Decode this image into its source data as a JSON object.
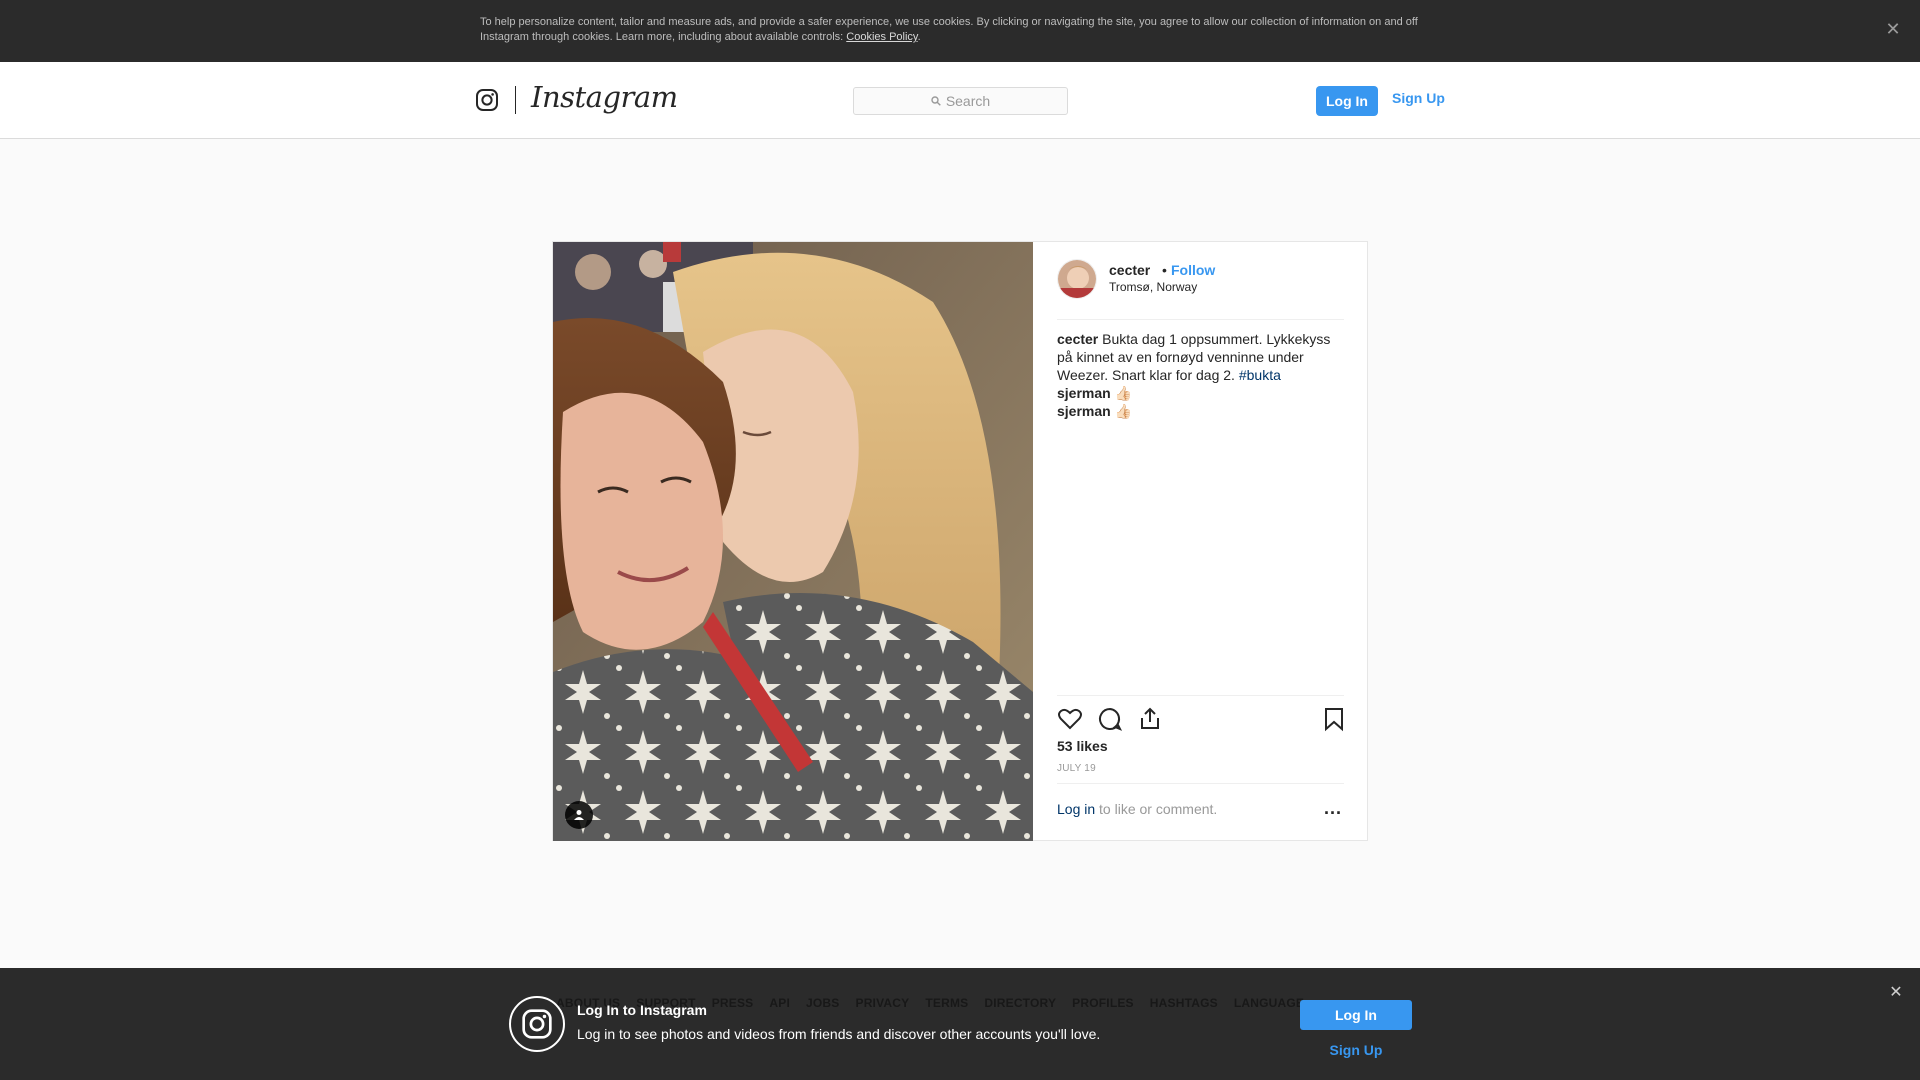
{
  "cookie": {
    "text": "To help personalize content, tailor and measure ads, and provide a safer experience, we use cookies. By clicking or navigating the site, you agree to allow our collection of information on and off Instagram through cookies. Learn more, including about available controls: ",
    "link": "Cookies Policy",
    "period": ".",
    "close_icon": "close-icon"
  },
  "header": {
    "wordmark": "Instagram",
    "search_placeholder": "Search",
    "login_label": "Log In",
    "signup_label": "Sign Up"
  },
  "post": {
    "username": "cecter",
    "separator": "•",
    "follow_label": "Follow",
    "location": "Tromsø, Norway",
    "caption_user": "cecter",
    "caption_text": " Bukta dag 1 oppsummert. Lykkekyss på kinnet av en fornøyd venninne under Weezer. Snart klar for dag 2. ",
    "caption_hashtag": "#bukta",
    "comments": [
      {
        "user": "sjerman",
        "text": " 👍🏻"
      },
      {
        "user": "sjerman",
        "text": " 👍🏻"
      }
    ],
    "likes": "53 likes",
    "date": "JULY 19",
    "comment_login_link": "Log in",
    "comment_login_text": " to like or comment.",
    "more_label": "..."
  },
  "footer": {
    "links": [
      "ABOUT US",
      "SUPPORT",
      "PRESS",
      "API",
      "JOBS",
      "PRIVACY",
      "TERMS",
      "DIRECTORY",
      "PROFILES",
      "HASHTAGS",
      "LANGUAGE"
    ]
  },
  "login_banner": {
    "title": "Log In to Instagram",
    "subtitle": "Log in to see photos and videos from friends and discover other accounts you'll love.",
    "login_label": "Log In",
    "signup_label": "Sign Up"
  },
  "colors": {
    "accent": "#3897f0",
    "link_dark": "#003569",
    "banner_bg": "#2b2b2b"
  }
}
